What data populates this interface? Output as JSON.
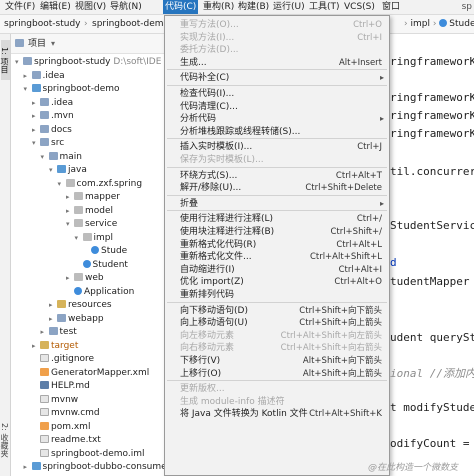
{
  "menubar": {
    "items": [
      "文件(F)",
      "编辑(E)",
      "视图(V)",
      "导航(N)",
      "代码(C)",
      "重构(R)",
      "构建(B)",
      "运行(U)",
      "工具(T)",
      "VCS(S)",
      "窗口"
    ],
    "right_text": "sp"
  },
  "breadcrumbs": {
    "project": "springboot-study",
    "module": "springboot-demo",
    "impl": "impl",
    "class_tab": "StudentS"
  },
  "project_panel": {
    "title": "项目",
    "strip_label": "1: 项目",
    "fav_label": "2: 收藏夹",
    "tree": [
      {
        "label": "springboot-study",
        "extra": "D:\\soft\\IDE",
        "depth": 0,
        "arrow": "▾",
        "icon": "folder"
      },
      {
        "label": ".idea",
        "depth": 1,
        "arrow": "▸",
        "icon": "folder"
      },
      {
        "label": "springboot-demo",
        "depth": 1,
        "arrow": "▾",
        "icon": "folder-src"
      },
      {
        "label": ".idea",
        "depth": 2,
        "arrow": "▸",
        "icon": "folder"
      },
      {
        "label": ".mvn",
        "depth": 2,
        "arrow": "▸",
        "icon": "folder"
      },
      {
        "label": "docs",
        "depth": 2,
        "arrow": "▸",
        "icon": "folder"
      },
      {
        "label": "src",
        "depth": 2,
        "arrow": "▾",
        "icon": "folder"
      },
      {
        "label": "main",
        "depth": 3,
        "arrow": "▾",
        "icon": "folder"
      },
      {
        "label": "java",
        "depth": 4,
        "arrow": "▾",
        "icon": "folder-src"
      },
      {
        "label": "com.zxf.spring",
        "depth": 5,
        "arrow": "▾",
        "icon": "pkg"
      },
      {
        "label": "mapper",
        "depth": 6,
        "arrow": "▸",
        "icon": "pkg"
      },
      {
        "label": "model",
        "depth": 6,
        "arrow": "▸",
        "icon": "pkg"
      },
      {
        "label": "service",
        "depth": 6,
        "arrow": "▾",
        "icon": "pkg"
      },
      {
        "label": "impl",
        "depth": 7,
        "arrow": "▾",
        "icon": "pkg"
      },
      {
        "label": "Stude",
        "depth": 8,
        "arrow": "",
        "icon": "cls"
      },
      {
        "label": "Student",
        "depth": 7,
        "arrow": "",
        "icon": "cls"
      },
      {
        "label": "web",
        "depth": 6,
        "arrow": "▸",
        "icon": "pkg"
      },
      {
        "label": "Application",
        "depth": 6,
        "arrow": "",
        "icon": "cls"
      },
      {
        "label": "resources",
        "depth": 4,
        "arrow": "▸",
        "icon": "folder-y"
      },
      {
        "label": "webapp",
        "depth": 4,
        "arrow": "▸",
        "icon": "folder"
      },
      {
        "label": "test",
        "depth": 3,
        "arrow": "▸",
        "icon": "folder"
      },
      {
        "label": "target",
        "depth": 2,
        "arrow": "▸",
        "icon": "folder-y",
        "excluded": true
      },
      {
        "label": ".gitignore",
        "depth": 2,
        "arrow": "",
        "icon": "file"
      },
      {
        "label": "GeneratorMapper.xml",
        "depth": 2,
        "arrow": "",
        "icon": "xml"
      },
      {
        "label": "HELP.md",
        "depth": 2,
        "arrow": "",
        "icon": "md"
      },
      {
        "label": "mvnw",
        "depth": 2,
        "arrow": "",
        "icon": "file"
      },
      {
        "label": "mvnw.cmd",
        "depth": 2,
        "arrow": "",
        "icon": "file"
      },
      {
        "label": "pom.xml",
        "depth": 2,
        "arrow": "",
        "icon": "xml"
      },
      {
        "label": "readme.txt",
        "depth": 2,
        "arrow": "",
        "icon": "file"
      },
      {
        "label": "springboot-demo.iml",
        "depth": 2,
        "arrow": "",
        "icon": "file"
      },
      {
        "label": "springboot-dubbo-consumer",
        "depth": 1,
        "arrow": "▸",
        "icon": "folder-src"
      }
    ]
  },
  "code_menu": {
    "items": [
      {
        "label": "重写方法(O)...",
        "shortcut": "Ctrl+O",
        "disabled": true
      },
      {
        "label": "实现方法(I)...",
        "shortcut": "Ctrl+I",
        "disabled": true
      },
      {
        "label": "委托方法(D)...",
        "shortcut": "",
        "disabled": true
      },
      {
        "label": "生成...",
        "shortcut": "Alt+Insert",
        "disabled": false
      },
      {
        "sep": true
      },
      {
        "label": "代码补全(C)",
        "shortcut": "",
        "submenu": true
      },
      {
        "sep": true
      },
      {
        "label": "检查代码(I)...",
        "shortcut": ""
      },
      {
        "label": "代码清理(C)...",
        "shortcut": ""
      },
      {
        "label": "分析代码",
        "shortcut": "",
        "submenu": true
      },
      {
        "label": "分析堆栈跟踪或线程转储(S)...",
        "shortcut": ""
      },
      {
        "sep": true
      },
      {
        "label": "插入实时模板(I)...",
        "shortcut": "Ctrl+J"
      },
      {
        "label": "保存为实时模板(L)...",
        "shortcut": "",
        "disabled": true
      },
      {
        "sep": true
      },
      {
        "label": "环绕方式(S)...",
        "shortcut": "Ctrl+Alt+T"
      },
      {
        "label": "解开/移除(U)...",
        "shortcut": "Ctrl+Shift+Delete"
      },
      {
        "sep": true
      },
      {
        "label": "折叠",
        "shortcut": "",
        "submenu": true
      },
      {
        "sep": true
      },
      {
        "label": "使用行注释进行注释(L)",
        "shortcut": "Ctrl+/"
      },
      {
        "label": "使用块注释进行注释(B)",
        "shortcut": "Ctrl+Shift+/"
      },
      {
        "label": "重新格式化代码(R)",
        "shortcut": "Ctrl+Alt+L"
      },
      {
        "label": "重新格式化文件...",
        "shortcut": "Ctrl+Alt+Shift+L"
      },
      {
        "label": "自动缩进行(I)",
        "shortcut": "Ctrl+Alt+I"
      },
      {
        "label": "优化 import(Z)",
        "shortcut": "Ctrl+Alt+O"
      },
      {
        "label": "重新排列代码",
        "shortcut": ""
      },
      {
        "sep": true
      },
      {
        "label": "向下移动语句(D)",
        "shortcut": "Ctrl+Shift+向下箭头"
      },
      {
        "label": "向上移动语句(U)",
        "shortcut": "Ctrl+Shift+向上箭头"
      },
      {
        "label": "向左移动元素",
        "shortcut": "Ctrl+Alt+Shift+向左箭头",
        "disabled": true
      },
      {
        "label": "向右移动元素",
        "shortcut": "Ctrl+Alt+Shift+向右箭头",
        "disabled": true
      },
      {
        "label": "下移行(V)",
        "shortcut": "Alt+Shift+向下箭头"
      },
      {
        "label": "上移行(O)",
        "shortcut": "Alt+Shift+向上箭头"
      },
      {
        "sep": true
      },
      {
        "label": "更新版权...",
        "shortcut": "",
        "disabled": true
      },
      {
        "label": "生成 module-info 描述符",
        "shortcut": "",
        "disabled": true
      },
      {
        "label": "将 Java 文件转换为 Kotlin 文件",
        "shortcut": "Ctrl+Alt+Shift+K"
      }
    ]
  },
  "editor": {
    "lines": [
      {
        "text": "ringframeworK",
        "cls": ""
      },
      {
        "text": "ringframeworK",
        "cls": ""
      },
      {
        "text": "ringframeworK",
        "cls": ""
      },
      {
        "text": "ringframeworK",
        "cls": ""
      },
      {
        "text": "til.concurrer",
        "cls": ""
      },
      {
        "text": "StudentServic",
        "cls": ""
      },
      {
        "text": "d",
        "cls": "kw"
      },
      {
        "text": "tudentMapper",
        "cls": ""
      },
      {
        "text": "udent querySt",
        "cls": ""
      },
      {
        "text": "ional //添加内",
        "cls": "comment"
      },
      {
        "text": "t modifyStude",
        "cls": ""
      },
      {
        "text": "odifyCount =",
        "cls": ""
      }
    ]
  },
  "watermark": "@在此构造一个微数支"
}
